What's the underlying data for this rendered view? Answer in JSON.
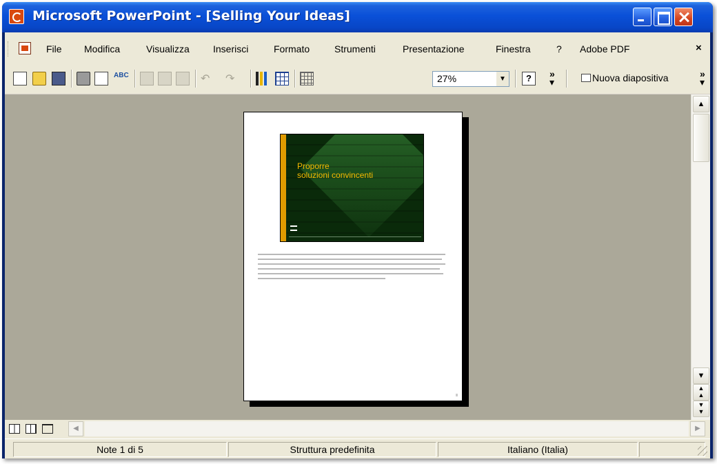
{
  "window": {
    "title": "Microsoft PowerPoint - [Selling Your Ideas]"
  },
  "menubar": {
    "items": [
      "File",
      "Modifica",
      "Visualizza",
      "Inserisci",
      "Formato",
      "Strumenti",
      "Presentazione",
      "Finestra",
      "?",
      "Adobe PDF"
    ],
    "close_glyph": "×"
  },
  "toolbar": {
    "zoom_value": "27%",
    "new_slide_label": "Nuova diapositiva",
    "buttons": [
      "new-icon",
      "open-icon",
      "save-icon",
      "print-icon",
      "print-preview-icon",
      "spelling-icon",
      "copy-icon",
      "paste-icon",
      "format-painter-icon",
      "undo-icon",
      "redo-icon",
      "insert-chart-icon",
      "insert-table-icon",
      "show-grid-icon",
      "help-icon"
    ]
  },
  "slide": {
    "title_line1": "Proporre",
    "title_line2": "soluzioni convincenti",
    "colors": {
      "background": "#0a2a0a",
      "accent": "#e09b00",
      "title": "#f5b800"
    }
  },
  "statusbar": {
    "page": "Note 1 di 5",
    "design": "Struttura predefinita",
    "language": "Italiano (Italia)"
  }
}
